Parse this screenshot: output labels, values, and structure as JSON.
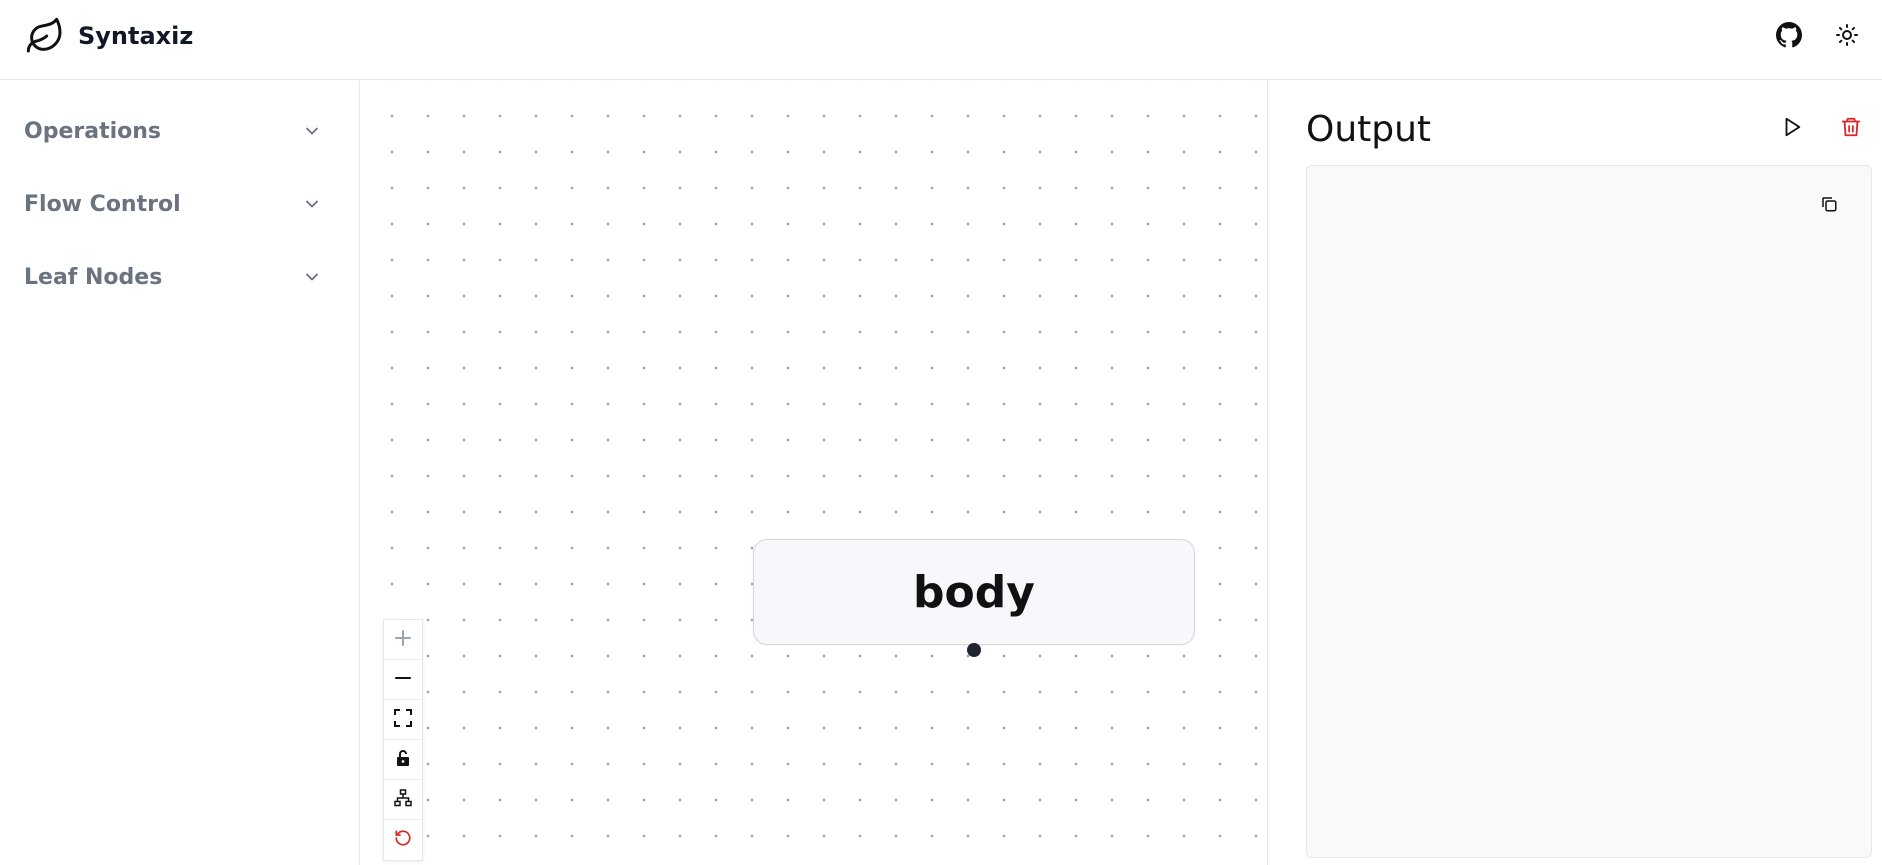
{
  "app": {
    "title": "Syntaxiz"
  },
  "header": {
    "icons": [
      "leaf-icon",
      "github-icon",
      "sun-icon"
    ]
  },
  "sidebar": {
    "sections": [
      {
        "label": "Operations",
        "icon": "chevron-down-icon"
      },
      {
        "label": "Flow Control",
        "icon": "chevron-down-icon"
      },
      {
        "label": "Leaf Nodes",
        "icon": "chevron-down-icon"
      }
    ]
  },
  "canvas": {
    "node": {
      "label": "body"
    },
    "controls": [
      "plus-icon",
      "minus-icon",
      "fit-view-icon",
      "unlock-icon",
      "tree-layout-icon",
      "reset-icon"
    ]
  },
  "output": {
    "title": "Output",
    "content": "",
    "icons": [
      "play-icon",
      "trash-icon",
      "copy-icon"
    ]
  },
  "colors": {
    "accent_danger": "#dc2626",
    "text_muted": "#6b7280",
    "handle": "#1f2430"
  }
}
